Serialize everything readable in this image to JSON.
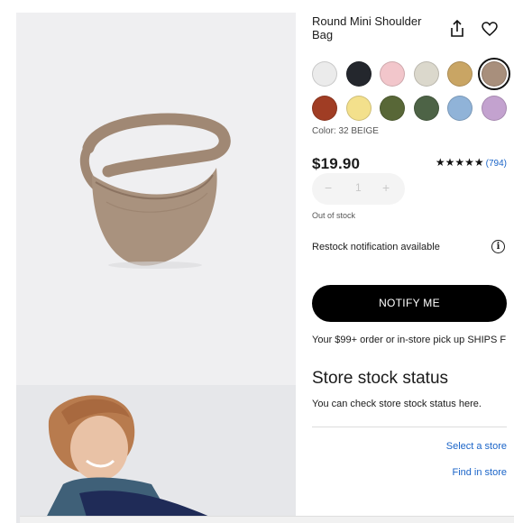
{
  "product": {
    "title": "Round Mini Shoulder Bag",
    "color_label": "Color: 32 BEIGE",
    "price": "$19.90",
    "stars": "★★★★★",
    "review_count": "(794)",
    "quantity": "1",
    "stock_status": "Out of stock",
    "restock_text": "Restock notification available",
    "notify_button": "NOTIFY ME",
    "shipping_text": "Your $99+ order or in-store pick up SHIPS F"
  },
  "stepper": {
    "minus": "−",
    "plus": "+"
  },
  "info_glyph": "i",
  "swatches": [
    {
      "name": "white",
      "color": "#ebebeb"
    },
    {
      "name": "black",
      "color": "#24272d"
    },
    {
      "name": "pink",
      "color": "#f2c6cb"
    },
    {
      "name": "light-gray",
      "color": "#dbd8cc"
    },
    {
      "name": "mustard",
      "color": "#c9a564"
    },
    {
      "name": "beige",
      "color": "#a88f7c",
      "selected": true
    },
    {
      "name": "brick",
      "color": "#a03d24"
    },
    {
      "name": "yellow",
      "color": "#f3e08c"
    },
    {
      "name": "olive",
      "color": "#586737"
    },
    {
      "name": "dark-green",
      "color": "#4d6346"
    },
    {
      "name": "light-blue",
      "color": "#90b3d8"
    },
    {
      "name": "lavender",
      "color": "#c3a2cf"
    }
  ],
  "store": {
    "title": "Store stock status",
    "description": "You can check store stock status here.",
    "select_link": "Select a store",
    "find_link": "Find in store"
  },
  "icons": {
    "share": "share-icon",
    "favorite": "heart-icon",
    "info": "info-icon"
  }
}
